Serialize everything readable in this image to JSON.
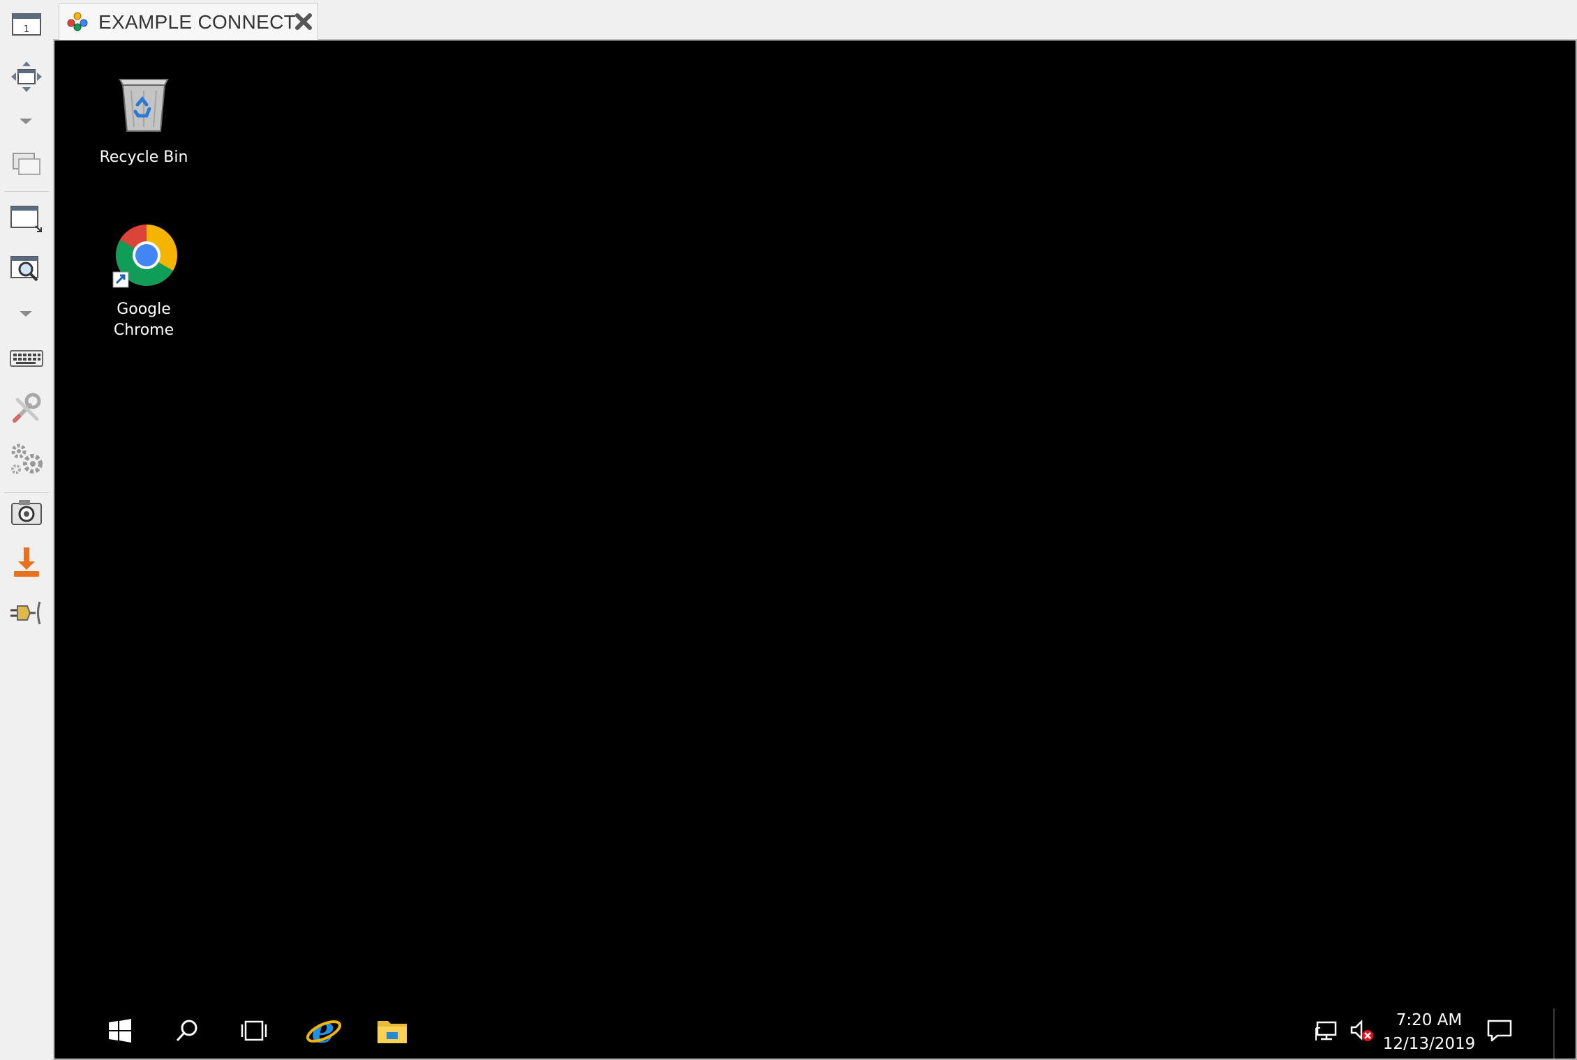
{
  "tab": {
    "title": "EXAMPLE CONNECT"
  },
  "toolbar": {
    "items": [
      "session-icon",
      "fit-window-icon",
      "windows-icon",
      "resize-window-icon",
      "zoom-icon",
      "keyboard-icon",
      "tools-icon",
      "settings-icon",
      "screenshot-icon",
      "transfer-icon",
      "disconnect-icon"
    ]
  },
  "desktop": {
    "background": "#000000",
    "icons": [
      {
        "label": "Recycle Bin"
      },
      {
        "label_line1": "Google",
        "label_line2": "Chrome"
      }
    ]
  },
  "taskbar": {
    "items": [
      "start-icon",
      "search-icon",
      "task-view-icon",
      "internet-explorer-icon",
      "file-explorer-icon"
    ],
    "tray": {
      "time": "7:20 AM",
      "date": "12/13/2019"
    }
  },
  "colors": {
    "chrome_red": "#db4437",
    "chrome_green": "#0f9d58",
    "chrome_yellow": "#f4b400",
    "chrome_blue": "#4285f4",
    "ie_blue": "#1e90e8",
    "folder_yellow": "#f8d155"
  }
}
